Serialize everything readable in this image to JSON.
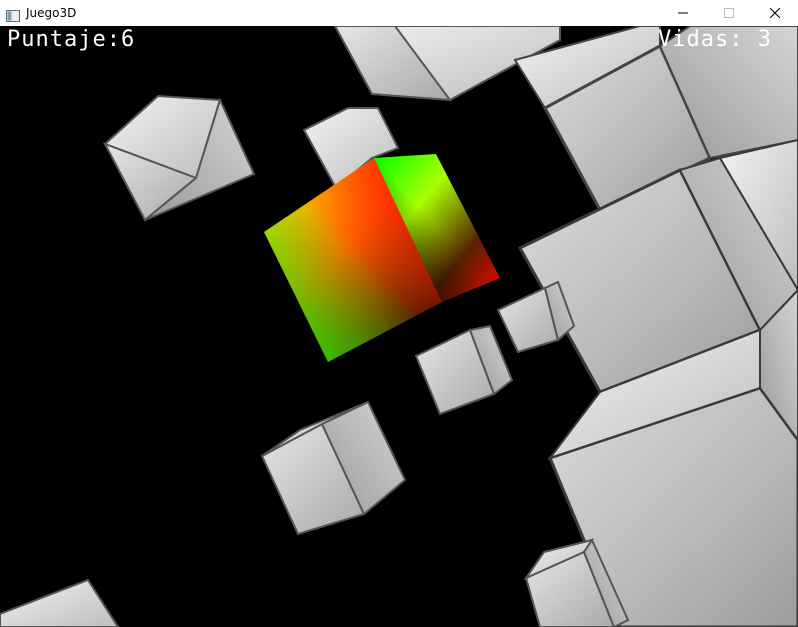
{
  "window": {
    "title": "Juego3D",
    "icon": "app-window-icon",
    "controls": [
      "minimize-icon",
      "maximize-icon",
      "close-icon"
    ]
  },
  "hud": {
    "score_label": "Puntaje:",
    "score_value": "6",
    "lives_label": "Vidas:",
    "lives_value": "3"
  },
  "scene": {
    "background": "#000000",
    "obstacle_color": "#c8c8c8",
    "player_cube_colors": [
      "#ff0000",
      "#00ff00",
      "#ffff00",
      "#000000"
    ]
  }
}
